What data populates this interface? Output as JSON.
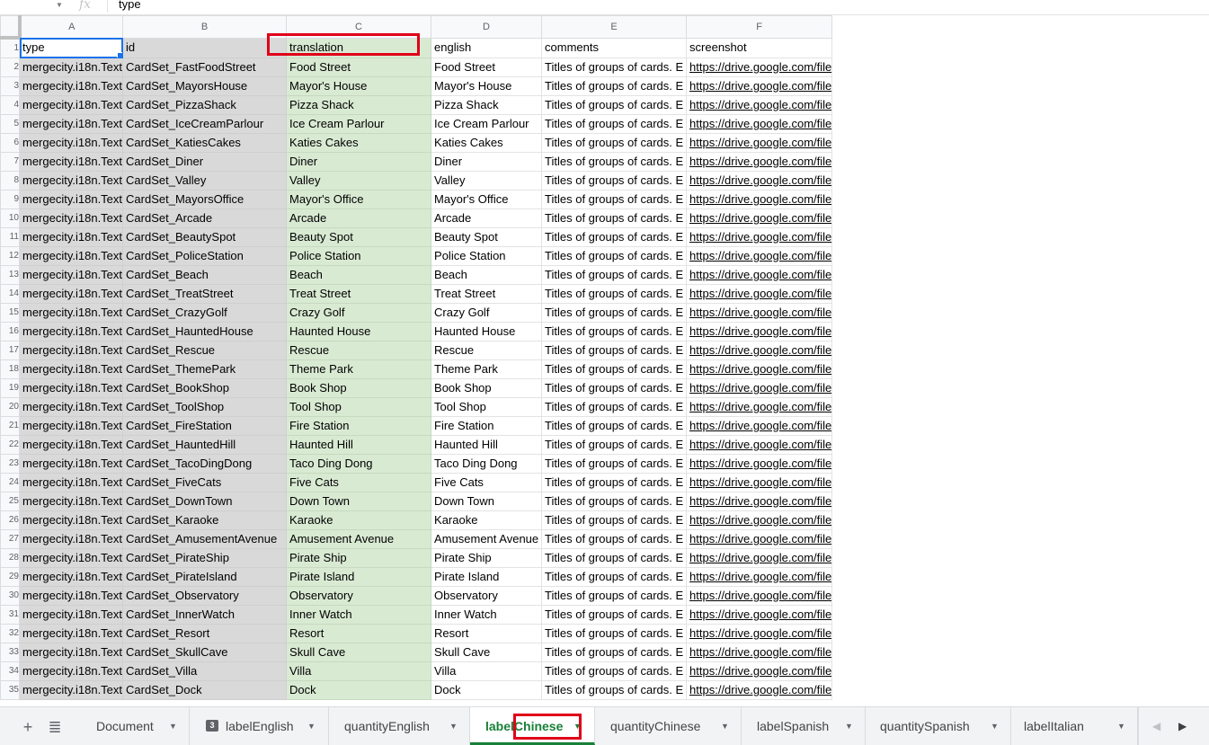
{
  "formula_bar": {
    "fx_symbol": "fx",
    "value": "type"
  },
  "columns": [
    "A",
    "B",
    "C",
    "D",
    "E",
    "F"
  ],
  "header_row": {
    "row_number": "1",
    "cells": [
      "type",
      "id",
      "translation",
      "english",
      "comments",
      "screenshot"
    ]
  },
  "rows": [
    {
      "n": "2",
      "type": "mergecity.i18n.Text",
      "id": "CardSet_FastFoodStreet",
      "translation": "Food Street",
      "english": "Food Street",
      "comments": "Titles of groups of cards. E",
      "screenshot": "https://drive.google.com/file"
    },
    {
      "n": "3",
      "type": "mergecity.i18n.Text",
      "id": "CardSet_MayorsHouse",
      "translation": "Mayor's House",
      "english": "Mayor's House",
      "comments": "Titles of groups of cards. E",
      "screenshot": "https://drive.google.com/file"
    },
    {
      "n": "4",
      "type": "mergecity.i18n.Text",
      "id": "CardSet_PizzaShack",
      "translation": "Pizza Shack",
      "english": "Pizza Shack",
      "comments": "Titles of groups of cards. E",
      "screenshot": "https://drive.google.com/file"
    },
    {
      "n": "5",
      "type": "mergecity.i18n.Text",
      "id": "CardSet_IceCreamParlour",
      "translation": "Ice Cream Parlour",
      "english": "Ice Cream Parlour",
      "comments": "Titles of groups of cards. E",
      "screenshot": "https://drive.google.com/file"
    },
    {
      "n": "6",
      "type": "mergecity.i18n.Text",
      "id": "CardSet_KatiesCakes",
      "translation": "Katies Cakes",
      "english": "Katies Cakes",
      "comments": "Titles of groups of cards. E",
      "screenshot": "https://drive.google.com/file"
    },
    {
      "n": "7",
      "type": "mergecity.i18n.Text",
      "id": "CardSet_Diner",
      "translation": "Diner",
      "english": "Diner",
      "comments": "Titles of groups of cards. E",
      "screenshot": "https://drive.google.com/file"
    },
    {
      "n": "8",
      "type": "mergecity.i18n.Text",
      "id": "CardSet_Valley",
      "translation": "Valley",
      "english": "Valley",
      "comments": "Titles of groups of cards. E",
      "screenshot": "https://drive.google.com/file"
    },
    {
      "n": "9",
      "type": "mergecity.i18n.Text",
      "id": "CardSet_MayorsOffice",
      "translation": "Mayor's Office",
      "english": "Mayor's Office",
      "comments": "Titles of groups of cards. E",
      "screenshot": "https://drive.google.com/file"
    },
    {
      "n": "10",
      "type": "mergecity.i18n.Text",
      "id": "CardSet_Arcade",
      "translation": "Arcade",
      "english": "Arcade",
      "comments": "Titles of groups of cards. E",
      "screenshot": "https://drive.google.com/file"
    },
    {
      "n": "11",
      "type": "mergecity.i18n.Text",
      "id": "CardSet_BeautySpot",
      "translation": "Beauty Spot",
      "english": "Beauty Spot",
      "comments": "Titles of groups of cards. E",
      "screenshot": "https://drive.google.com/file"
    },
    {
      "n": "12",
      "type": "mergecity.i18n.Text",
      "id": "CardSet_PoliceStation",
      "translation": "Police Station",
      "english": "Police Station",
      "comments": "Titles of groups of cards. E",
      "screenshot": "https://drive.google.com/file"
    },
    {
      "n": "13",
      "type": "mergecity.i18n.Text",
      "id": "CardSet_Beach",
      "translation": "Beach",
      "english": "Beach",
      "comments": "Titles of groups of cards. E",
      "screenshot": "https://drive.google.com/file"
    },
    {
      "n": "14",
      "type": "mergecity.i18n.Text",
      "id": "CardSet_TreatStreet",
      "translation": "Treat Street",
      "english": "Treat Street",
      "comments": "Titles of groups of cards. E",
      "screenshot": "https://drive.google.com/file"
    },
    {
      "n": "15",
      "type": "mergecity.i18n.Text",
      "id": "CardSet_CrazyGolf",
      "translation": "Crazy Golf",
      "english": "Crazy Golf",
      "comments": "Titles of groups of cards. E",
      "screenshot": "https://drive.google.com/file"
    },
    {
      "n": "16",
      "type": "mergecity.i18n.Text",
      "id": "CardSet_HauntedHouse",
      "translation": "Haunted House",
      "english": "Haunted House",
      "comments": "Titles of groups of cards. E",
      "screenshot": "https://drive.google.com/file"
    },
    {
      "n": "17",
      "type": "mergecity.i18n.Text",
      "id": "CardSet_Rescue",
      "translation": "Rescue",
      "english": "Rescue",
      "comments": "Titles of groups of cards. E",
      "screenshot": "https://drive.google.com/file"
    },
    {
      "n": "18",
      "type": "mergecity.i18n.Text",
      "id": "CardSet_ThemePark",
      "translation": "Theme Park",
      "english": "Theme Park",
      "comments": "Titles of groups of cards. E",
      "screenshot": "https://drive.google.com/file"
    },
    {
      "n": "19",
      "type": "mergecity.i18n.Text",
      "id": "CardSet_BookShop",
      "translation": "Book Shop",
      "english": "Book Shop",
      "comments": "Titles of groups of cards. E",
      "screenshot": "https://drive.google.com/file"
    },
    {
      "n": "20",
      "type": "mergecity.i18n.Text",
      "id": "CardSet_ToolShop",
      "translation": "Tool Shop",
      "english": "Tool Shop",
      "comments": "Titles of groups of cards. E",
      "screenshot": "https://drive.google.com/file"
    },
    {
      "n": "21",
      "type": "mergecity.i18n.Text",
      "id": "CardSet_FireStation",
      "translation": "Fire Station",
      "english": "Fire Station",
      "comments": "Titles of groups of cards. E",
      "screenshot": "https://drive.google.com/file"
    },
    {
      "n": "22",
      "type": "mergecity.i18n.Text",
      "id": "CardSet_HauntedHill",
      "translation": "Haunted Hill",
      "english": "Haunted Hill",
      "comments": "Titles of groups of cards. E",
      "screenshot": "https://drive.google.com/file"
    },
    {
      "n": "23",
      "type": "mergecity.i18n.Text",
      "id": "CardSet_TacoDingDong",
      "translation": "Taco Ding Dong",
      "english": "Taco Ding Dong",
      "comments": "Titles of groups of cards. E",
      "screenshot": "https://drive.google.com/file"
    },
    {
      "n": "24",
      "type": "mergecity.i18n.Text",
      "id": "CardSet_FiveCats",
      "translation": "Five Cats",
      "english": "Five Cats",
      "comments": "Titles of groups of cards. E",
      "screenshot": "https://drive.google.com/file"
    },
    {
      "n": "25",
      "type": "mergecity.i18n.Text",
      "id": "CardSet_DownTown",
      "translation": "Down Town",
      "english": "Down Town",
      "comments": "Titles of groups of cards. E",
      "screenshot": "https://drive.google.com/file"
    },
    {
      "n": "26",
      "type": "mergecity.i18n.Text",
      "id": "CardSet_Karaoke",
      "translation": "Karaoke",
      "english": "Karaoke",
      "comments": "Titles of groups of cards. E",
      "screenshot": "https://drive.google.com/file"
    },
    {
      "n": "27",
      "type": "mergecity.i18n.Text",
      "id": "CardSet_AmusementAvenue",
      "translation": "Amusement Avenue",
      "english": "Amusement Avenue",
      "comments": "Titles of groups of cards. E",
      "screenshot": "https://drive.google.com/file"
    },
    {
      "n": "28",
      "type": "mergecity.i18n.Text",
      "id": "CardSet_PirateShip",
      "translation": "Pirate Ship",
      "english": "Pirate Ship",
      "comments": "Titles of groups of cards. E",
      "screenshot": "https://drive.google.com/file"
    },
    {
      "n": "29",
      "type": "mergecity.i18n.Text",
      "id": "CardSet_PirateIsland",
      "translation": "Pirate Island",
      "english": "Pirate Island",
      "comments": "Titles of groups of cards. E",
      "screenshot": "https://drive.google.com/file"
    },
    {
      "n": "30",
      "type": "mergecity.i18n.Text",
      "id": "CardSet_Observatory",
      "translation": "Observatory",
      "english": "Observatory",
      "comments": "Titles of groups of cards. E",
      "screenshot": "https://drive.google.com/file"
    },
    {
      "n": "31",
      "type": "mergecity.i18n.Text",
      "id": "CardSet_InnerWatch",
      "translation": "Inner Watch",
      "english": "Inner Watch",
      "comments": "Titles of groups of cards. E",
      "screenshot": "https://drive.google.com/file"
    },
    {
      "n": "32",
      "type": "mergecity.i18n.Text",
      "id": "CardSet_Resort",
      "translation": "Resort",
      "english": "Resort",
      "comments": "Titles of groups of cards. E",
      "screenshot": "https://drive.google.com/file"
    },
    {
      "n": "33",
      "type": "mergecity.i18n.Text",
      "id": "CardSet_SkullCave",
      "translation": "Skull Cave",
      "english": "Skull Cave",
      "comments": "Titles of groups of cards. E",
      "screenshot": "https://drive.google.com/file"
    },
    {
      "n": "34",
      "type": "mergecity.i18n.Text",
      "id": "CardSet_Villa",
      "translation": "Villa",
      "english": "Villa",
      "comments": "Titles of groups of cards. E",
      "screenshot": "https://drive.google.com/file"
    },
    {
      "n": "35",
      "type": "mergecity.i18n.Text",
      "id": "CardSet_Dock",
      "translation": "Dock",
      "english": "Dock",
      "comments": "Titles of groups of cards. E",
      "screenshot": "https://drive.google.com/file"
    }
  ],
  "sheet_tabs": {
    "add_icon": "plus-icon",
    "all_sheets_icon": "list-icon",
    "active_index": 3,
    "tabs": [
      {
        "label": "Document"
      },
      {
        "label": "labelEnglish",
        "badge": "3"
      },
      {
        "label": "quantityEnglish"
      },
      {
        "label": "labelChinese"
      },
      {
        "label": "quantityChinese"
      },
      {
        "label": "labelSpanish"
      },
      {
        "label": "quantitySpanish"
      },
      {
        "label": "labelItalian"
      }
    ]
  },
  "colors": {
    "id_column_fill": "#d9d9d9",
    "translation_column_fill": "#d9ead3",
    "highlight_box": "#e00018",
    "active_tab_text": "#188038",
    "selection": "#1a73e8"
  }
}
